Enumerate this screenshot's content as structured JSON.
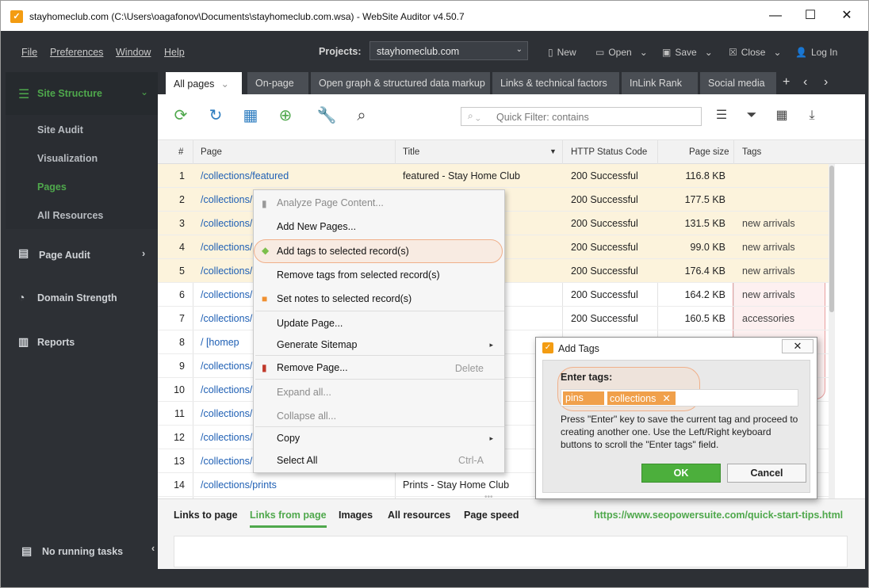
{
  "title": "stayhomeclub.com (C:\\Users\\oagafonov\\Documents\\stayhomeclub.com.wsa) - WebSite Auditor v4.50.7",
  "menu": {
    "file": "File",
    "preferences": "Preferences",
    "window": "Window",
    "help": "Help"
  },
  "projects": {
    "label": "Projects:",
    "value": "stayhomeclub.com"
  },
  "toolbar": {
    "new": "New",
    "open": "Open",
    "save": "Save",
    "close": "Close",
    "login": "Log In"
  },
  "sidebar": {
    "site_structure": "Site Structure",
    "sub": [
      "Site Audit",
      "Visualization",
      "Pages",
      "All Resources"
    ],
    "page_audit": "Page Audit",
    "domain_strength": "Domain Strength",
    "reports": "Reports",
    "tasks": "No running tasks"
  },
  "tabs": [
    "All pages",
    "On-page",
    "Open graph & structured data markup",
    "Links & technical factors",
    "InLink Rank",
    "Social media"
  ],
  "quick_filter": "Quick Filter: contains",
  "columns": {
    "num": "#",
    "page": "Page",
    "title": "Title",
    "status": "HTTP Status Code",
    "size": "Page size",
    "tags": "Tags"
  },
  "rows": [
    {
      "n": "1",
      "page": "/collections/featured",
      "title": "featured - Stay Home Club",
      "status": "200 Successful",
      "size": "116.8 KB",
      "tags": ""
    },
    {
      "n": "2",
      "page": "/collections/",
      "title": "ome Club",
      "status": "200 Successful",
      "size": "177.5 KB",
      "tags": ""
    },
    {
      "n": "3",
      "page": "/collections/",
      "title": "ub",
      "status": "200 Successful",
      "size": "131.5 KB",
      "tags": "new arrivals"
    },
    {
      "n": "4",
      "page": "/collections/",
      "title": "y Home",
      "status": "200 Successful",
      "size": "99.0 KB",
      "tags": "new arrivals"
    },
    {
      "n": "5",
      "page": "/collections/",
      "title": "ome Club",
      "status": "200 Successful",
      "size": "176.4 KB",
      "tags": "new arrivals"
    },
    {
      "n": "6",
      "page": "/collections/",
      "title": "Club",
      "status": "200 Successful",
      "size": "164.2 KB",
      "tags": "new arrivals"
    },
    {
      "n": "7",
      "page": "/collections/",
      "title": "ub",
      "status": "200 Successful",
      "size": "160.5 KB",
      "tags": "accessories"
    },
    {
      "n": "8",
      "page": "/ [homep",
      "title": "Home",
      "status": "",
      "size": "",
      "tags": ""
    },
    {
      "n": "9",
      "page": "/collections/",
      "title": "b",
      "status": "",
      "size": "",
      "tags": ""
    },
    {
      "n": "10",
      "page": "/collections/",
      "title": "- Stay",
      "status": "",
      "size": "",
      "tags": ""
    },
    {
      "n": "11",
      "page": "/collections/",
      "title": "ub",
      "status": "",
      "size": "",
      "tags": ""
    },
    {
      "n": "12",
      "page": "/collections/",
      "title": "y Hom",
      "status": "",
      "size": "",
      "tags": ""
    },
    {
      "n": "13",
      "page": "/collections/",
      "title": "y Hom",
      "status": "",
      "size": "",
      "tags": ""
    },
    {
      "n": "14",
      "page": "/collections/prints",
      "title": "Prints - Stay Home Club",
      "status": "",
      "size": "",
      "tags": ""
    }
  ],
  "context_menu": {
    "analyze": "Analyze Page Content...",
    "add_pages": "Add New Pages...",
    "add_tags": "Add tags to selected record(s)",
    "remove_tags": "Remove tags from selected record(s)",
    "set_notes": "Set notes to selected record(s)",
    "update": "Update Page...",
    "sitemap": "Generate Sitemap",
    "remove": "Remove Page...",
    "remove_sc": "Delete",
    "expand": "Expand all...",
    "collapse": "Collapse all...",
    "copy": "Copy",
    "select_all": "Select All",
    "select_all_sc": "Ctrl-A"
  },
  "dialog": {
    "title": "Add Tags",
    "label": "Enter tags:",
    "tags": [
      "pins",
      "collections"
    ],
    "help": "Press \"Enter\" key to save the current tag and proceed to creating another one. Use the Left/Right keyboard buttons to scroll the \"Enter tags\" field.",
    "ok": "OK",
    "cancel": "Cancel"
  },
  "bottom": {
    "tabs": [
      "Links to page",
      "Links from page",
      "Images",
      "All resources",
      "Page speed"
    ],
    "link": "https://www.seopowersuite.com/quick-start-tips.html"
  },
  "colors": {
    "accent": "#4fa84c",
    "dark": "#2d3035",
    "highlight": "#fcf3dc",
    "tag": "#f0a04b"
  }
}
